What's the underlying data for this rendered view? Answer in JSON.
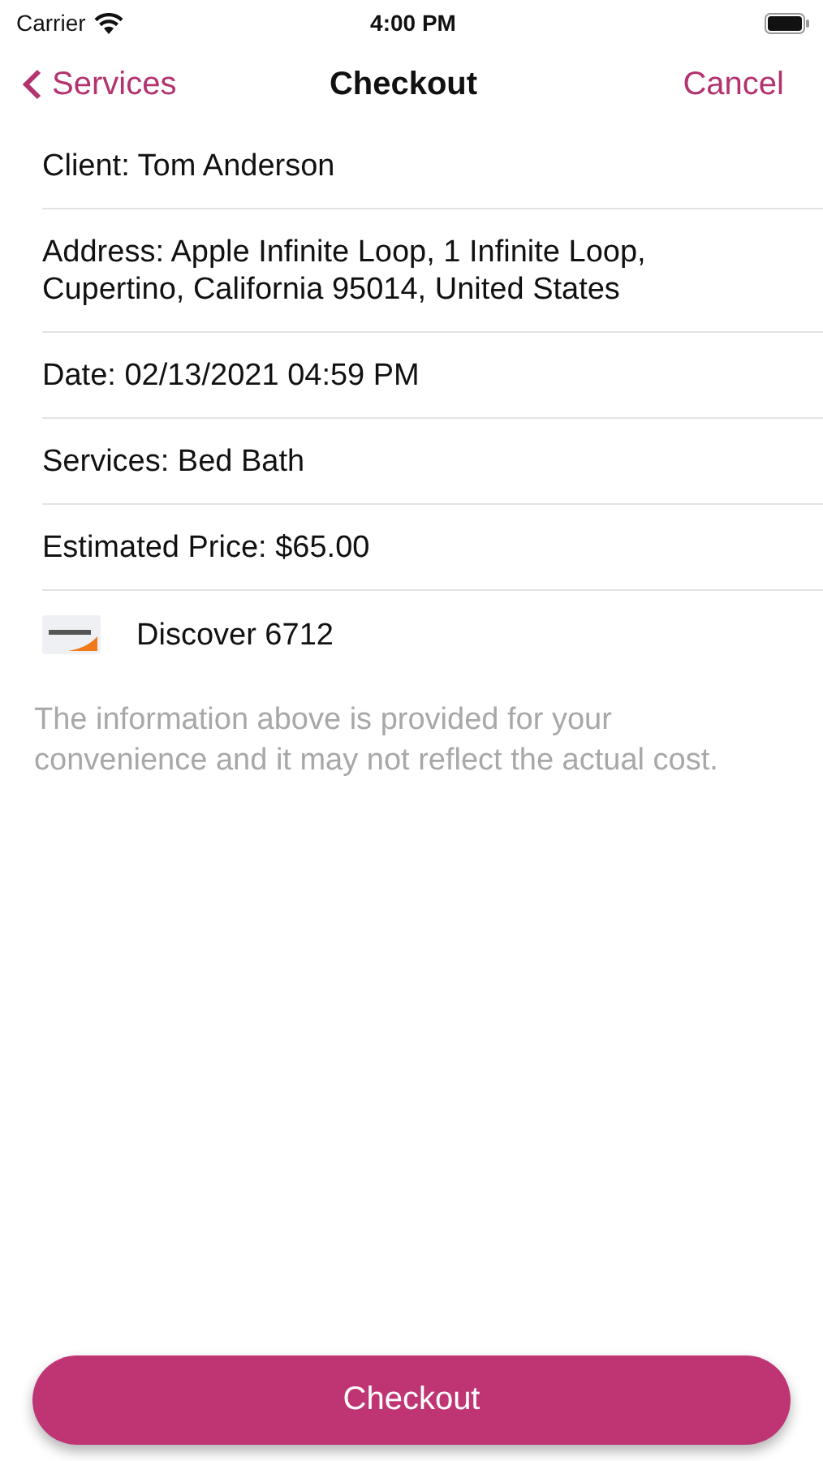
{
  "status_bar": {
    "carrier": "Carrier",
    "time": "4:00 PM"
  },
  "nav": {
    "back": "Services",
    "title": "Checkout",
    "action": "Cancel"
  },
  "rows": [
    {
      "kind": "text",
      "text": "Client: Tom Anderson"
    },
    {
      "kind": "text",
      "text": "Address: Apple Infinite Loop, 1 Infinite Loop, Cupertino, California 95014, United States"
    },
    {
      "kind": "text",
      "text": "Date: 02/13/2021 04:59 PM"
    },
    {
      "kind": "text",
      "text": "Services:  Bed Bath"
    },
    {
      "kind": "text",
      "text": "Estimated Price: $65.00"
    },
    {
      "kind": "card",
      "text": "Discover 6712"
    }
  ],
  "note": "The information above is provided for your convenience and it may not reflect the actual cost.",
  "button": "Checkout"
}
